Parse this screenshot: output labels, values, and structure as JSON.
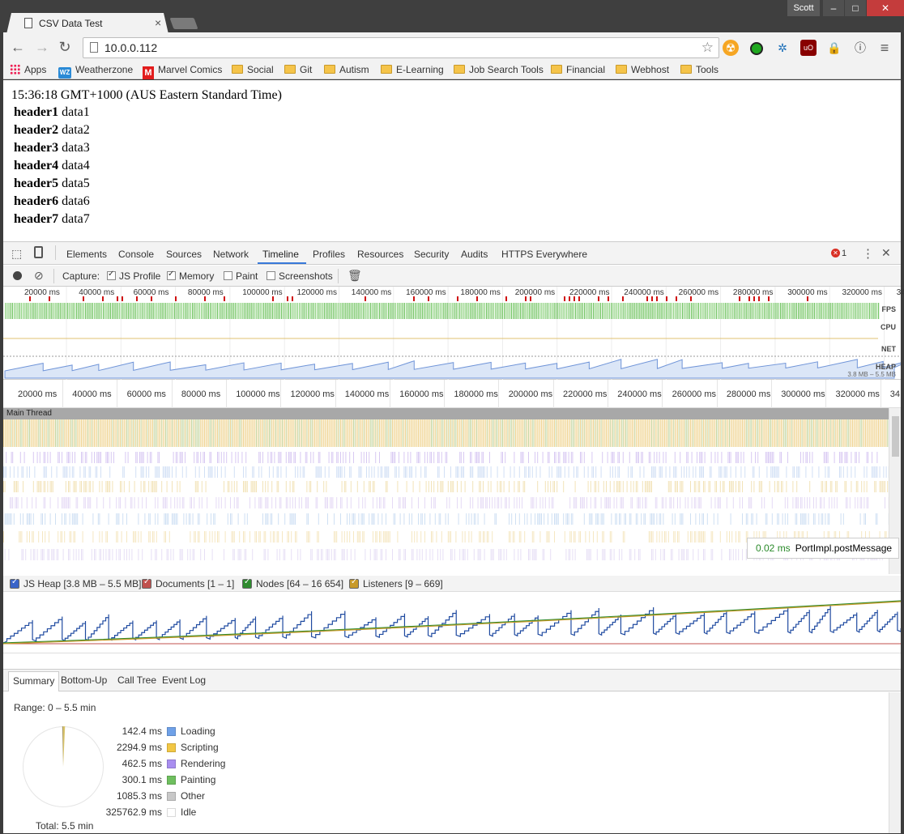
{
  "window": {
    "tab_title": "CSV Data Test",
    "tab_close": "×",
    "user": "Scott",
    "min": "–",
    "max": "□",
    "close": "✕"
  },
  "toolbar": {
    "back": "←",
    "forward": "→",
    "reload": "↻",
    "url": "10.0.0.112",
    "star": "☆",
    "menu": "⋮"
  },
  "bookmarks": [
    {
      "label": "Apps",
      "icon": "apps-grid-icon"
    },
    {
      "label": "Weatherzone",
      "icon": "weatherzone-icon",
      "badge": "WZ"
    },
    {
      "label": "Marvel Comics",
      "icon": "marvel-icon",
      "badge": "M"
    },
    {
      "label": "Social",
      "icon": "folder-icon"
    },
    {
      "label": "Git",
      "icon": "folder-icon"
    },
    {
      "label": "Autism",
      "icon": "folder-icon"
    },
    {
      "label": "E-Learning",
      "icon": "folder-icon"
    },
    {
      "label": "Job Search Tools",
      "icon": "folder-icon"
    },
    {
      "label": "Financial",
      "icon": "folder-icon"
    },
    {
      "label": "Webhost",
      "icon": "folder-icon"
    },
    {
      "label": "Tools",
      "icon": "folder-icon"
    }
  ],
  "page": {
    "time": "15:36:18 GMT+1000 (AUS Eastern Standard Time)",
    "rows": [
      {
        "header": "header1",
        "data": "data1"
      },
      {
        "header": "header2",
        "data": "data2"
      },
      {
        "header": "header3",
        "data": "data3"
      },
      {
        "header": "header4",
        "data": "data4"
      },
      {
        "header": "header5",
        "data": "data5"
      },
      {
        "header": "header6",
        "data": "data6"
      },
      {
        "header": "header7",
        "data": "data7"
      }
    ]
  },
  "devtools": {
    "tabs": [
      "Elements",
      "Console",
      "Sources",
      "Network",
      "Timeline",
      "Profiles",
      "Resources",
      "Security",
      "Audits",
      "HTTPS Everywhere"
    ],
    "active_tab": "Timeline",
    "error_count": "1",
    "capture_label": "Capture:",
    "capture_options": [
      {
        "label": "JS Profile",
        "checked": true
      },
      {
        "label": "Memory",
        "checked": true
      },
      {
        "label": "Paint",
        "checked": false
      },
      {
        "label": "Screenshots",
        "checked": false
      }
    ],
    "overview_ticks": [
      "20000 ms",
      "40000 ms",
      "60000 ms",
      "80000 ms",
      "100000 ms",
      "120000 ms",
      "140000 ms",
      "160000 ms",
      "180000 ms",
      "200000 ms",
      "220000 ms",
      "240000 ms",
      "260000 ms",
      "280000 ms",
      "300000 ms",
      "320000 ms",
      "34"
    ],
    "overview_labels": {
      "fps": "FPS",
      "cpu": "CPU",
      "net": "NET",
      "heap": "HEAP",
      "heap_range": "3.8 MB – 5.5 MB"
    },
    "main_thread_label": "Main Thread",
    "tooltip": {
      "ms": "0.02 ms",
      "fn": "PortImpl.postMessage"
    },
    "counters": [
      {
        "label": "JS Heap [3.8 MB – 5.5 MB]",
        "color": "#3a64c8"
      },
      {
        "label": "Documents [1 – 1]",
        "color": "#c0504d"
      },
      {
        "label": "Nodes [64 – 16 654]",
        "color": "#2e8b2e"
      },
      {
        "label": "Listeners [9 – 669]",
        "color": "#c89a2a"
      }
    ],
    "bottom_tabs": [
      "Summary",
      "Bottom-Up",
      "Call Tree",
      "Event Log"
    ],
    "summary": {
      "range": "Range: 0 – 5.5 min",
      "total": "Total: 5.5 min",
      "legend": [
        {
          "value": "142.4 ms",
          "label": "Loading",
          "color": "#6fa1e8"
        },
        {
          "value": "2294.9 ms",
          "label": "Scripting",
          "color": "#f2c744"
        },
        {
          "value": "462.5 ms",
          "label": "Rendering",
          "color": "#a98ef0"
        },
        {
          "value": "300.1 ms",
          "label": "Painting",
          "color": "#6fbf5f"
        },
        {
          "value": "1085.3 ms",
          "label": "Other",
          "color": "#c8c8c8"
        },
        {
          "value": "325762.9 ms",
          "label": "Idle",
          "color": "#ffffff"
        }
      ]
    }
  }
}
